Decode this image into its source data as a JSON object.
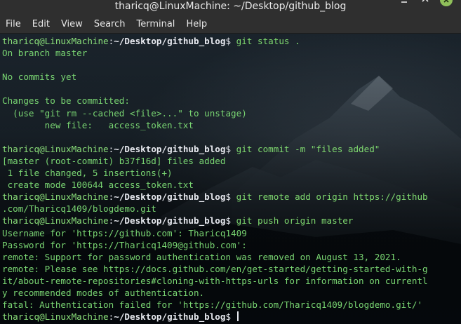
{
  "window": {
    "title": "tharicq@LinuxMachine: ~/Desktop/github_blog",
    "controls": [
      "minimize-icon",
      "maximize-icon",
      "close-icon"
    ],
    "accent": "#8fbf5a"
  },
  "menu": {
    "file": "File",
    "edit": "Edit",
    "view": "View",
    "search": "Search",
    "terminal": "Terminal",
    "help": "Help"
  },
  "prompt": {
    "user": "tharicq@LinuxMachine",
    "sep": ":",
    "path": "~/Desktop/github_blog",
    "symbol": "$"
  },
  "terminal": {
    "lines": [
      {
        "type": "prompt",
        "cmd": " git status ."
      },
      {
        "type": "out",
        "text": "On branch master"
      },
      {
        "type": "out",
        "text": ""
      },
      {
        "type": "out",
        "text": "No commits yet"
      },
      {
        "type": "out",
        "text": ""
      },
      {
        "type": "out",
        "text": "Changes to be committed:"
      },
      {
        "type": "out",
        "text": "  (use \"git rm --cached <file>...\" to unstage)"
      },
      {
        "type": "out",
        "text": "\tnew file:   access_token.txt"
      },
      {
        "type": "out",
        "text": ""
      },
      {
        "type": "prompt",
        "cmd": " git commit -m \"files added\""
      },
      {
        "type": "out",
        "text": "[master (root-commit) b37f16d] files added"
      },
      {
        "type": "out",
        "text": " 1 file changed, 5 insertions(+)"
      },
      {
        "type": "out",
        "text": " create mode 100644 access_token.txt"
      },
      {
        "type": "prompt",
        "cmd": " git remote add origin https://github"
      },
      {
        "type": "out",
        "text": ".com/Tharicq1409/blogdemo.git"
      },
      {
        "type": "prompt",
        "cmd": " git push origin master"
      },
      {
        "type": "out",
        "text": "Username for 'https://github.com': Tharicq1409"
      },
      {
        "type": "out",
        "text": "Password for 'https://Tharicq1409@github.com':"
      },
      {
        "type": "out",
        "text": "remote: Support for password authentication was removed on August 13, 2021."
      },
      {
        "type": "out",
        "text": "remote: Please see https://docs.github.com/en/get-started/getting-started-with-g"
      },
      {
        "type": "out",
        "text": "it/about-remote-repositories#cloning-with-https-urls for information on currentl"
      },
      {
        "type": "out",
        "text": "y recommended modes of authentication."
      },
      {
        "type": "out",
        "text": "fatal: Authentication failed for 'https://github.com/Tharicq1409/blogdemo.git/'"
      },
      {
        "type": "prompt",
        "cmd": " "
      }
    ]
  }
}
